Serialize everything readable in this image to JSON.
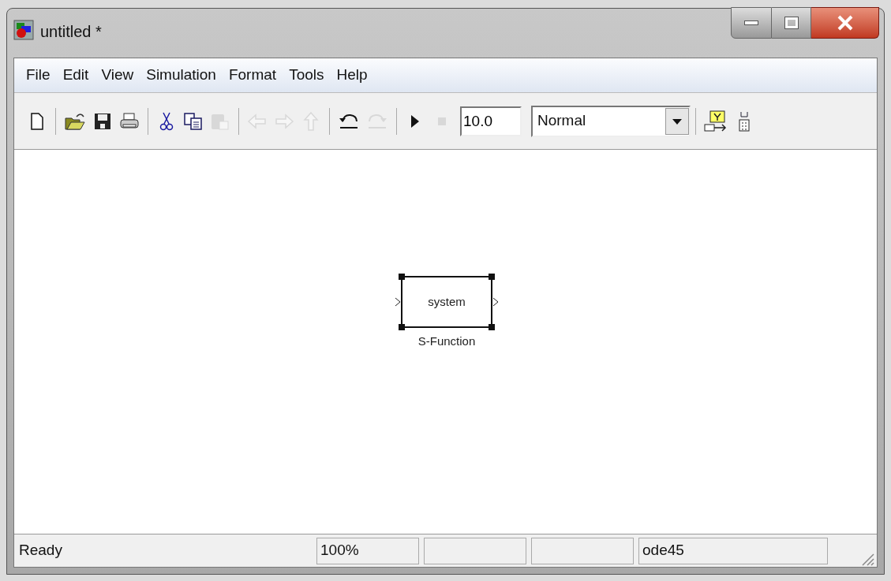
{
  "window": {
    "title": "untitled *"
  },
  "menu": [
    "File",
    "Edit",
    "View",
    "Simulation",
    "Format",
    "Tools",
    "Help"
  ],
  "toolbar": {
    "groups": [
      [
        {
          "disabled": false
        }
      ],
      [
        {
          "disabled": false
        },
        {
          "disabled": false
        },
        {
          "disabled": false
        }
      ],
      [
        {
          "disabled": false
        },
        {
          "disabled": false
        },
        {
          "disabled": true
        }
      ],
      [
        {
          "disabled": true
        },
        {
          "disabled": true
        },
        {
          "disabled": true
        }
      ],
      [
        {
          "disabled": false
        },
        {
          "disabled": true
        }
      ],
      [
        {
          "disabled": false
        },
        {
          "disabled": true
        }
      ]
    ],
    "stop_time": "10.0",
    "mode": "Normal",
    "tail": [
      {
        "disabled": false
      },
      {
        "disabled": false
      }
    ]
  },
  "block": {
    "name": "system",
    "label": "S-Function",
    "selected": true
  },
  "status_bar": [
    "Ready",
    "100%",
    "ode45"
  ]
}
